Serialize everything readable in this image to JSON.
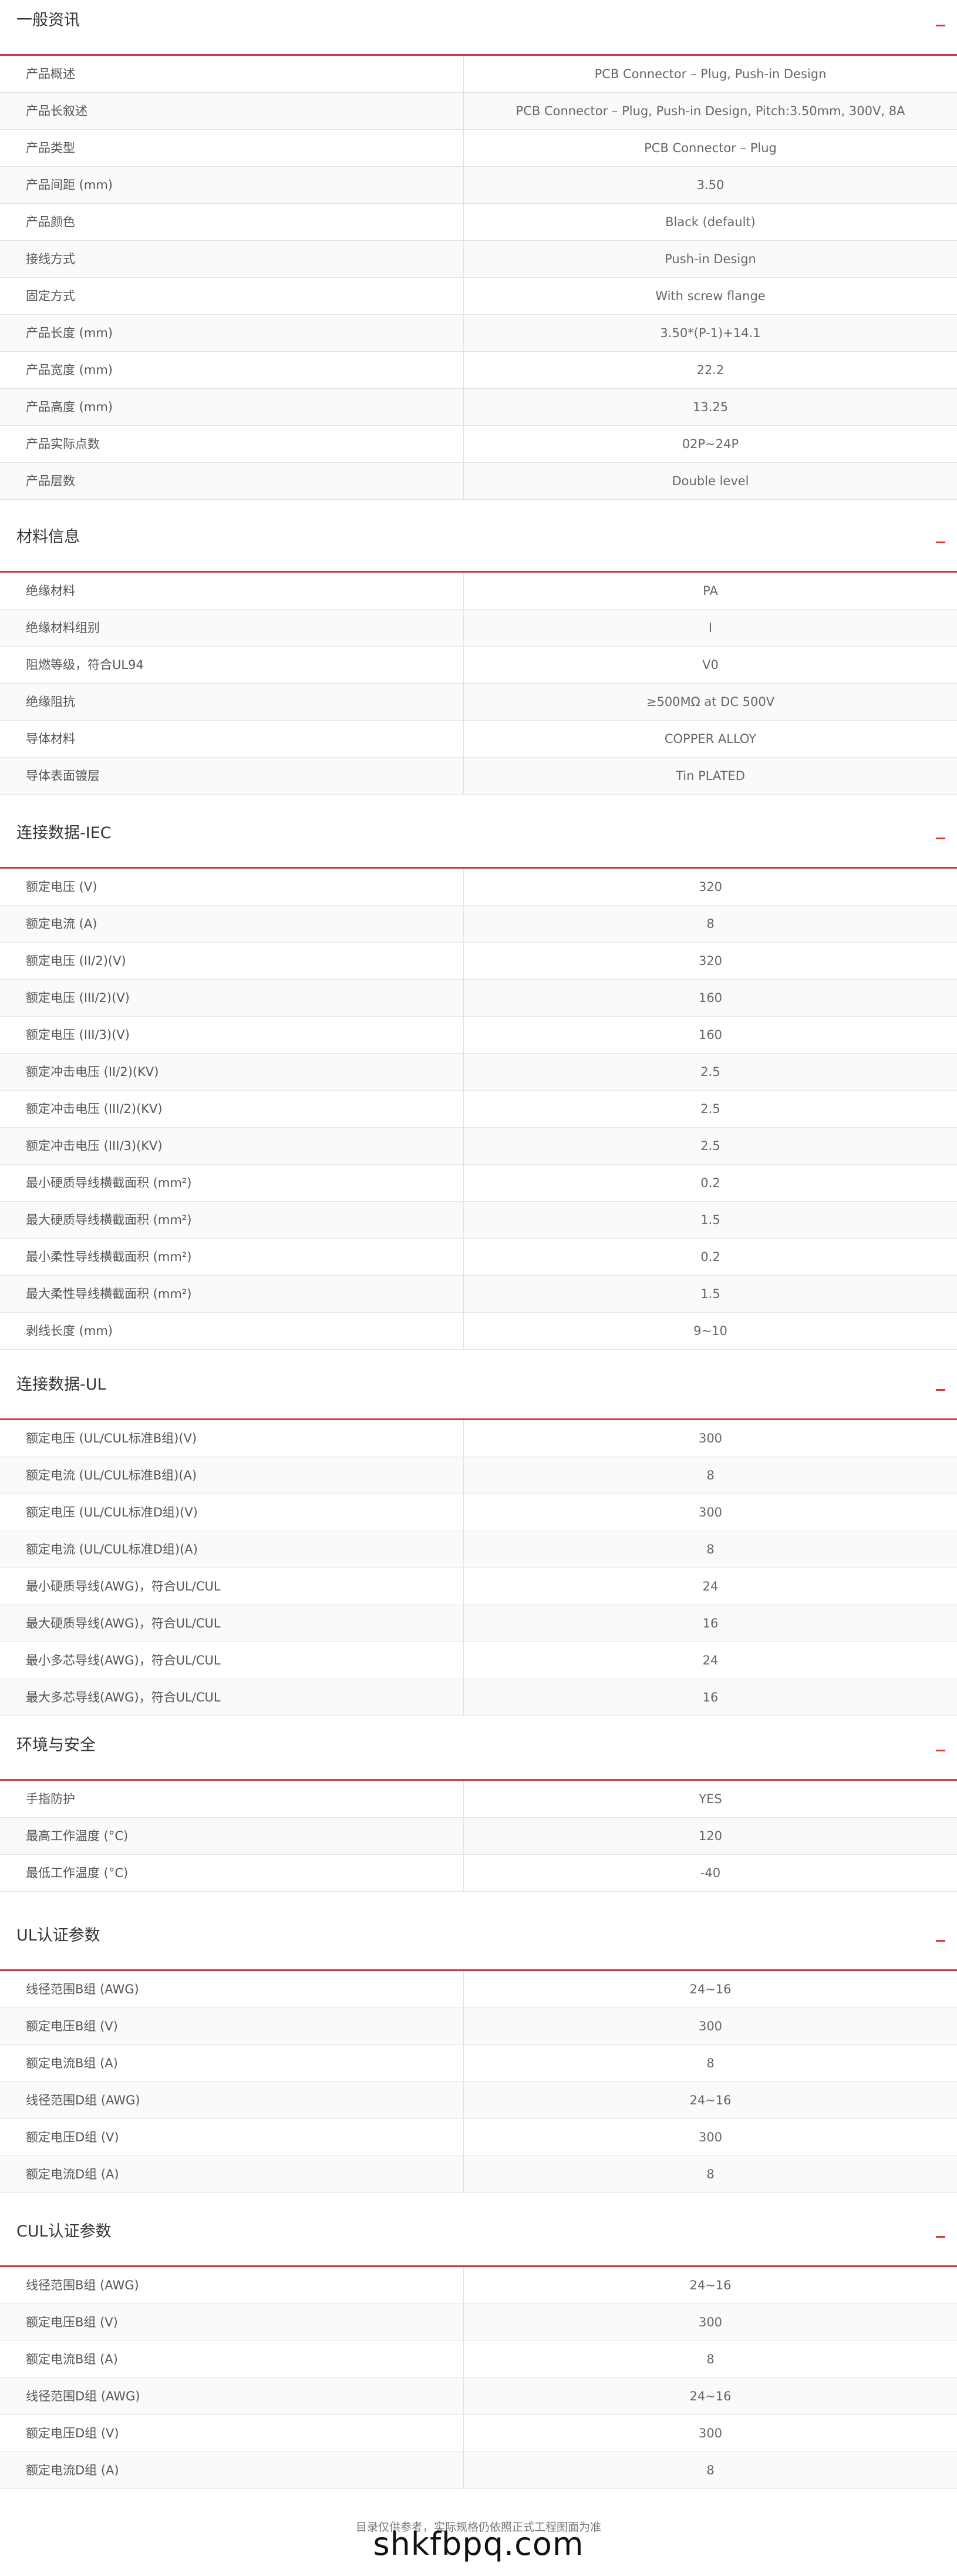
{
  "sections": [
    {
      "title": "一般资讯",
      "rows": [
        {
          "label": "产品概述",
          "value": "PCB Connector – Plug, Push-in Design"
        },
        {
          "label": "产品长叙述",
          "value": "PCB Connector – Plug, Push-in Design, Pitch:3.50mm, 300V, 8A"
        },
        {
          "label": "产品类型",
          "value": "PCB Connector – Plug"
        },
        {
          "label": "产品间距 (mm)",
          "value": "3.50"
        },
        {
          "label": "产品颜色",
          "value": "Black (default)"
        },
        {
          "label": "接线方式",
          "value": "Push-in Design"
        },
        {
          "label": "固定方式",
          "value": "With screw flange"
        },
        {
          "label": "产品长度 (mm)",
          "value": "3.50*(P-1)+14.1"
        },
        {
          "label": "产品宽度 (mm)",
          "value": "22.2"
        },
        {
          "label": "产品高度 (mm)",
          "value": "13.25"
        },
        {
          "label": "产品实际点数",
          "value": "02P~24P"
        },
        {
          "label": "产品层数",
          "value": "Double level"
        }
      ]
    },
    {
      "title": "材料信息",
      "rows": [
        {
          "label": "绝缘材料",
          "value": "PA"
        },
        {
          "label": "绝缘材料组别",
          "value": "I"
        },
        {
          "label": "阻燃等级，符合UL94",
          "value": "V0"
        },
        {
          "label": "绝缘阻抗",
          "value": "≥500MΩ at DC 500V"
        },
        {
          "label": "导体材料",
          "value": "COPPER ALLOY"
        },
        {
          "label": "导体表面镀层",
          "value": "Tin PLATED"
        }
      ]
    },
    {
      "title": "连接数据-IEC",
      "rows": [
        {
          "label": "额定电压 (V)",
          "value": "320"
        },
        {
          "label": "额定电流 (A)",
          "value": "8"
        },
        {
          "label": "额定电压 (II/2)(V)",
          "value": "320"
        },
        {
          "label": "额定电压 (III/2)(V)",
          "value": "160"
        },
        {
          "label": "额定电压 (III/3)(V)",
          "value": "160"
        },
        {
          "label": "额定冲击电压 (II/2)(KV)",
          "value": "2.5"
        },
        {
          "label": "额定冲击电压 (III/2)(KV)",
          "value": "2.5"
        },
        {
          "label": "额定冲击电压 (III/3)(KV)",
          "value": "2.5"
        },
        {
          "label": "最小硬质导线横截面积 (mm²)",
          "value": "0.2"
        },
        {
          "label": "最大硬质导线横截面积 (mm²)",
          "value": "1.5"
        },
        {
          "label": "最小柔性导线横截面积 (mm²)",
          "value": "0.2"
        },
        {
          "label": "最大柔性导线横截面积 (mm²)",
          "value": "1.5"
        },
        {
          "label": "剥线长度 (mm)",
          "value": "9~10"
        }
      ]
    },
    {
      "title": "连接数据-UL",
      "rows": [
        {
          "label": "额定电压 (UL/CUL标准B组)(V)",
          "value": "300"
        },
        {
          "label": "额定电流 (UL/CUL标准B组)(A)",
          "value": "8"
        },
        {
          "label": "额定电压 (UL/CUL标准D组)(V)",
          "value": "300"
        },
        {
          "label": "额定电流 (UL/CUL标准D组)(A)",
          "value": "8"
        },
        {
          "label": "最小硬质导线(AWG)，符合UL/CUL",
          "value": "24"
        },
        {
          "label": "最大硬质导线(AWG)，符合UL/CUL",
          "value": "16"
        },
        {
          "label": "最小多芯导线(AWG)，符合UL/CUL",
          "value": "24"
        },
        {
          "label": "最大多芯导线(AWG)，符合UL/CUL",
          "value": "16"
        }
      ]
    },
    {
      "title": "环境与安全",
      "rows": [
        {
          "label": "手指防护",
          "value": "YES"
        },
        {
          "label": "最高工作温度 (°C)",
          "value": "120"
        },
        {
          "label": "最低工作温度 (°C)",
          "value": "-40"
        }
      ]
    },
    {
      "title": "UL认证参数",
      "rows": [
        {
          "label": "线径范围B组 (AWG)",
          "value": "24~16"
        },
        {
          "label": "额定电压B组 (V)",
          "value": "300"
        },
        {
          "label": "额定电流B组 (A)",
          "value": "8"
        },
        {
          "label": "线径范围D组 (AWG)",
          "value": "24~16"
        },
        {
          "label": "额定电压D组 (V)",
          "value": "300"
        },
        {
          "label": "额定电流D组 (A)",
          "value": "8"
        }
      ]
    },
    {
      "title": "CUL认证参数",
      "rows": [
        {
          "label": "线径范围B组 (AWG)",
          "value": "24~16"
        },
        {
          "label": "额定电压B组 (V)",
          "value": "300"
        },
        {
          "label": "额定电流B组 (A)",
          "value": "8"
        },
        {
          "label": "线径范围D组 (AWG)",
          "value": "24~16"
        },
        {
          "label": "额定电压D组 (V)",
          "value": "300"
        },
        {
          "label": "额定电流D组 (A)",
          "value": "8"
        }
      ]
    }
  ],
  "footer": {
    "note": "目录仅供参考，实际规格仍依照正式工程图面为准"
  },
  "watermark": {
    "text": "shkfbpq.com"
  },
  "colors": {
    "accent": "#d9383f",
    "divider": "#e3e3e3"
  }
}
